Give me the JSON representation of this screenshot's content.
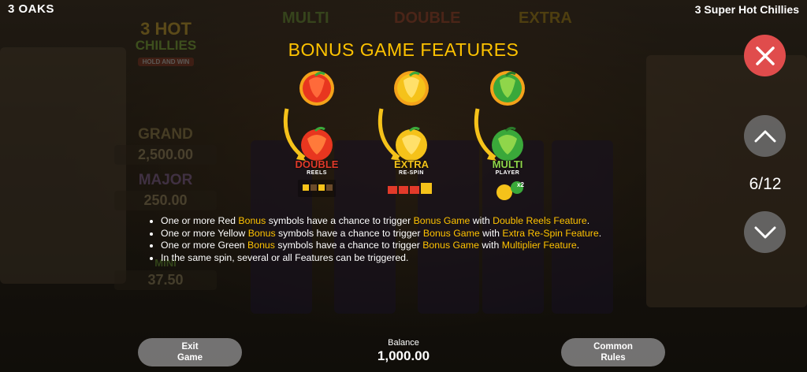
{
  "header": {
    "brand": "3 OAKS",
    "game_name": "3 Super Hot Chillies"
  },
  "logo": {
    "line1": "3 HOT",
    "line2": "CHILLIES",
    "line3": "HOLD AND WIN"
  },
  "background_banners": [
    "MULTI",
    "DOUBLE",
    "EXTRA"
  ],
  "jackpots": [
    {
      "label": "GRAND",
      "value": "2,500.00"
    },
    {
      "label": "MAJOR",
      "value": "250.00"
    },
    {
      "label": "MINI",
      "value": "37.50"
    }
  ],
  "title": "BONUS GAME FEATURES",
  "features": [
    {
      "main": "DOUBLE",
      "sub": "REELS",
      "color": "#e23a2a"
    },
    {
      "main": "EXTRA",
      "sub": "RE-SPIN",
      "color": "#f2c21a"
    },
    {
      "main": "MULTI",
      "sub": "PLAYER",
      "color": "#3aa83a",
      "badge": "x2"
    }
  ],
  "bullets": [
    [
      "One or more Red ",
      "Bonus",
      " symbols have a chance to trigger ",
      "Bonus Game",
      " with ",
      "Double Reels Feature",
      "."
    ],
    [
      "One or more Yellow ",
      "Bonus",
      " symbols have a chance to trigger ",
      "Bonus Game",
      " with ",
      "Extra Re-Spin Feature",
      "."
    ],
    [
      "One or more Green ",
      "Bonus",
      " symbols have a chance to trigger ",
      "Bonus Game",
      " with ",
      "Multiplier Feature",
      "."
    ],
    [
      "In the same spin, several or all Features can be triggered."
    ]
  ],
  "pagination": {
    "indicator": "6/12"
  },
  "footer": {
    "exit_line1": "Exit",
    "exit_line2": "Game",
    "balance_label": "Balance",
    "balance_value": "1,000.00",
    "rules_line1": "Common",
    "rules_line2": "Rules"
  },
  "colors": {
    "highlight": "#ffc300",
    "close": "#e04c4c",
    "red": "#e23a2a",
    "yellow": "#f2c21a",
    "green": "#3aa83a"
  }
}
